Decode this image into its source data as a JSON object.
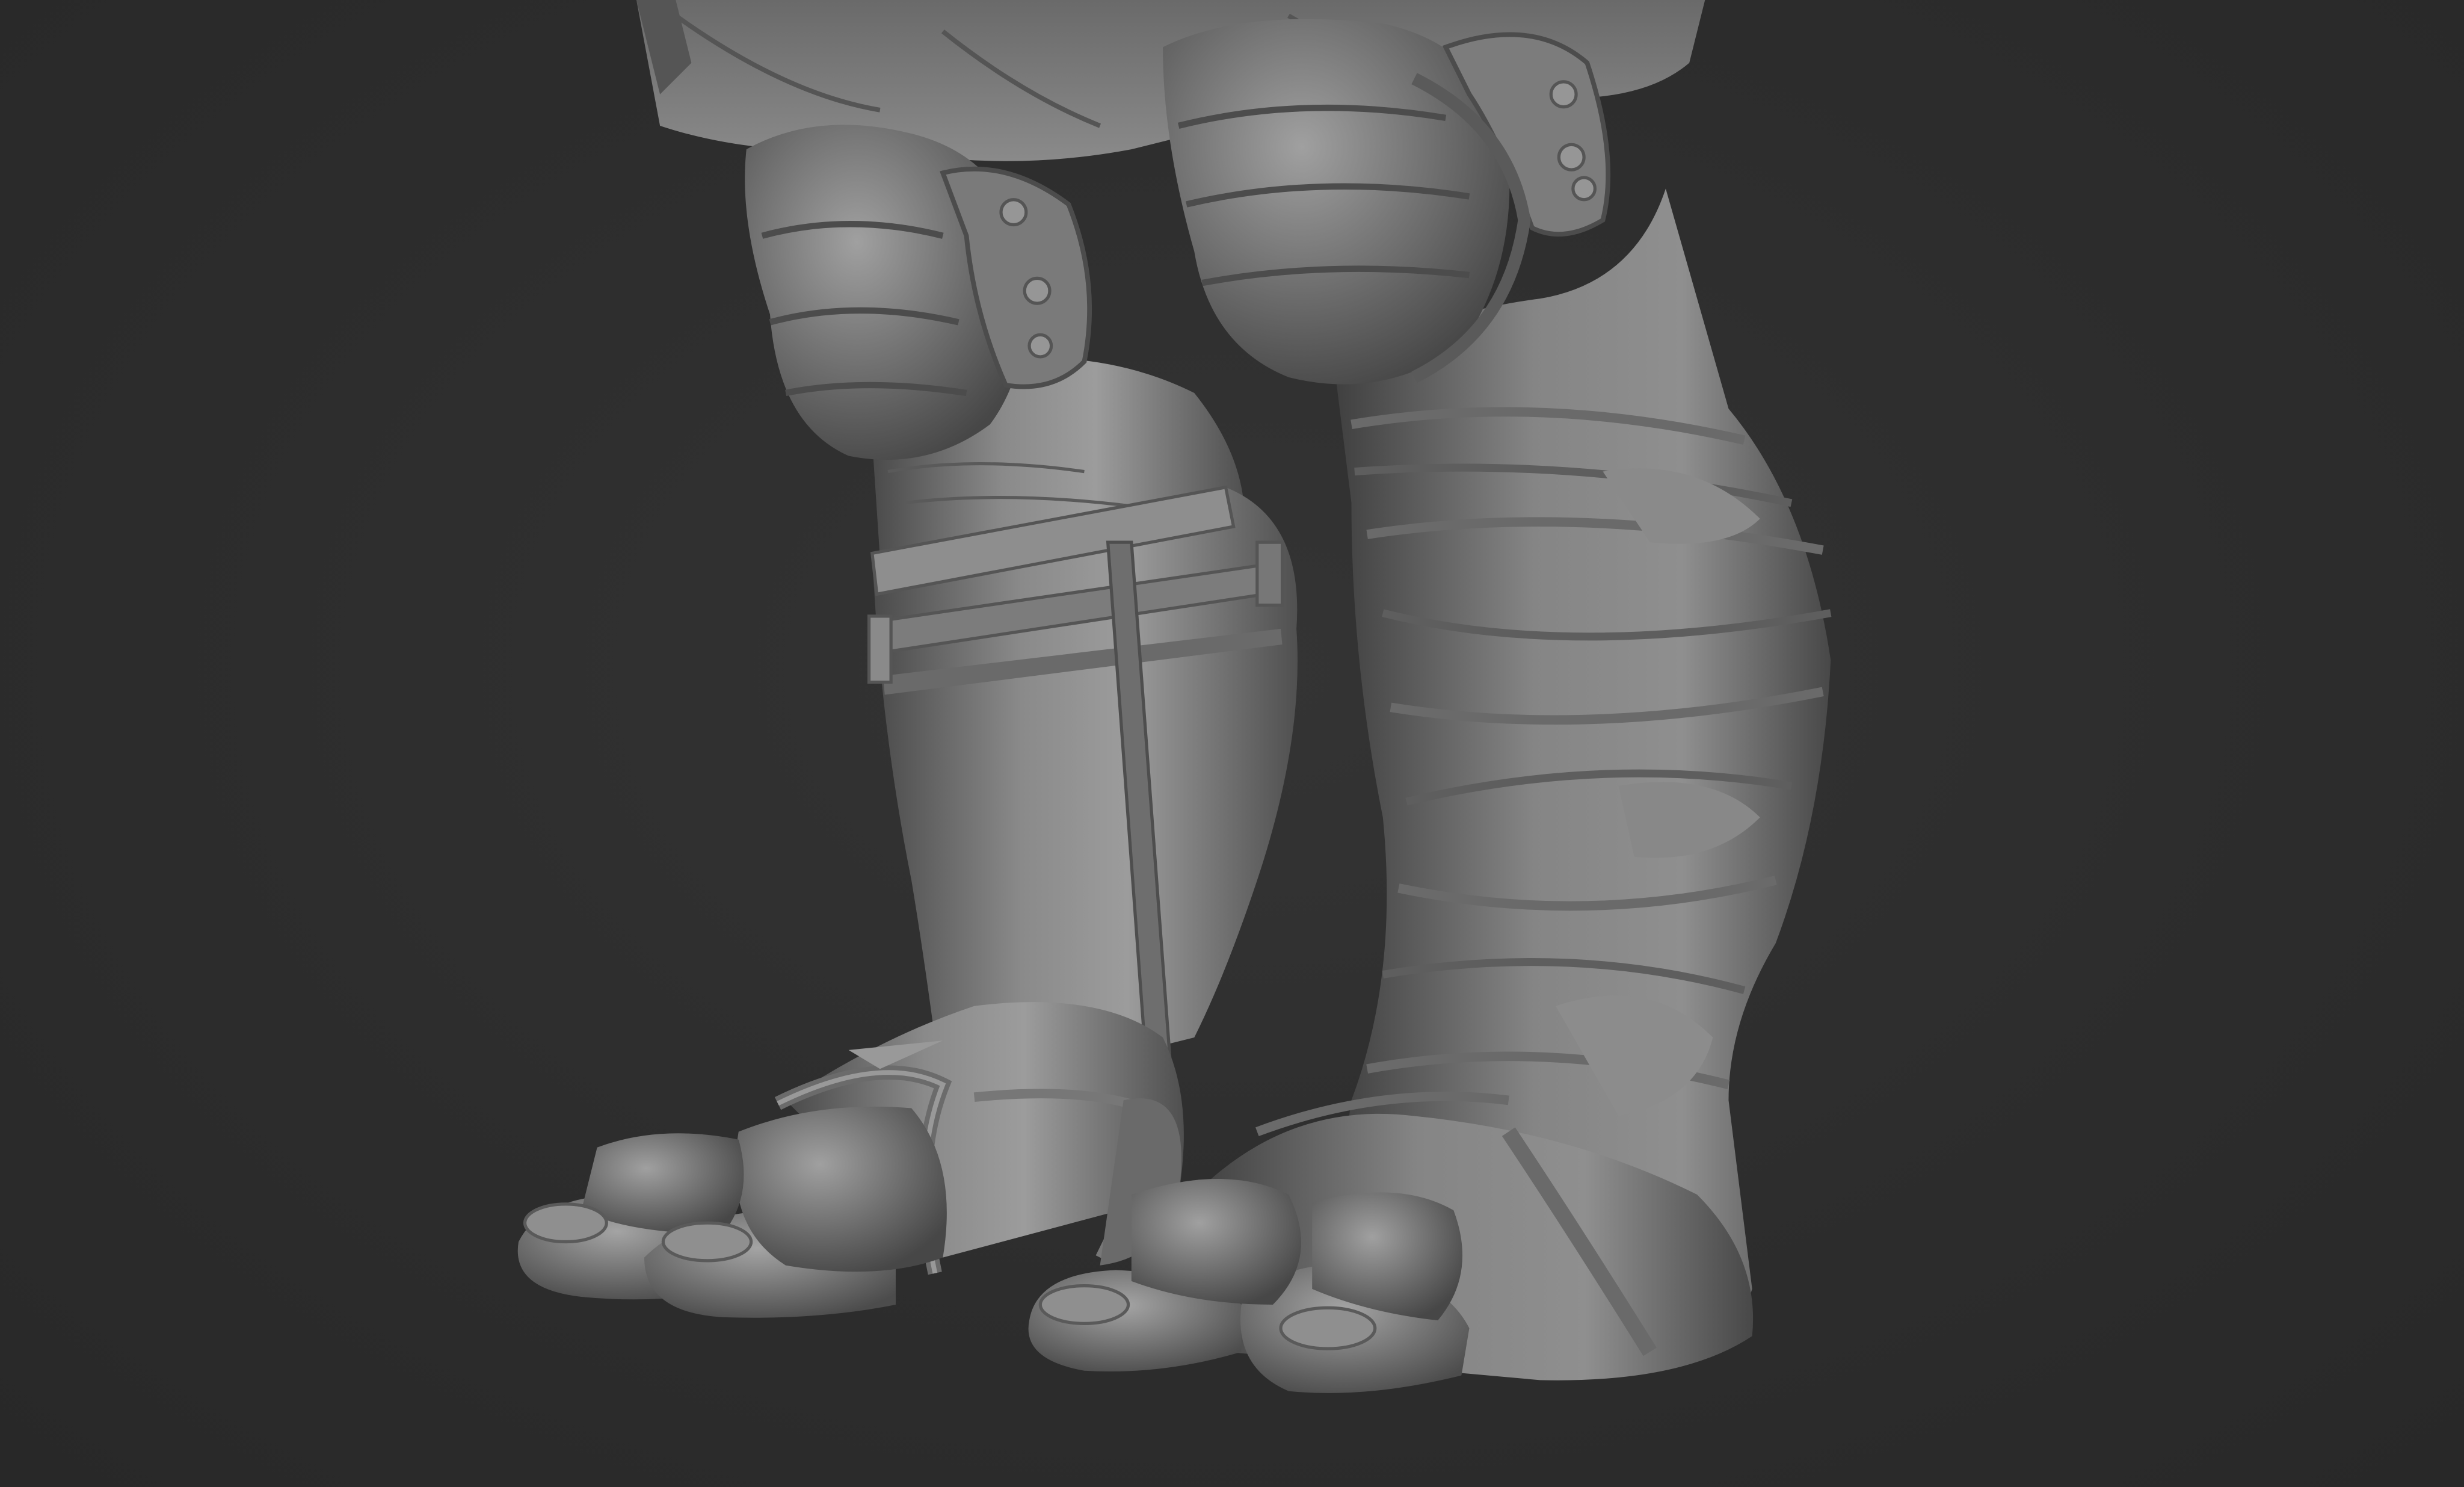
{
  "scene": {
    "subject": "sculpt-render",
    "colors": {
      "background": "#2c2c2c",
      "clay_light": "#a9a9a9",
      "clay_mid": "#7d7d7d",
      "clay_dark": "#3e3e3e",
      "shadow": "#1e1e1e"
    }
  }
}
